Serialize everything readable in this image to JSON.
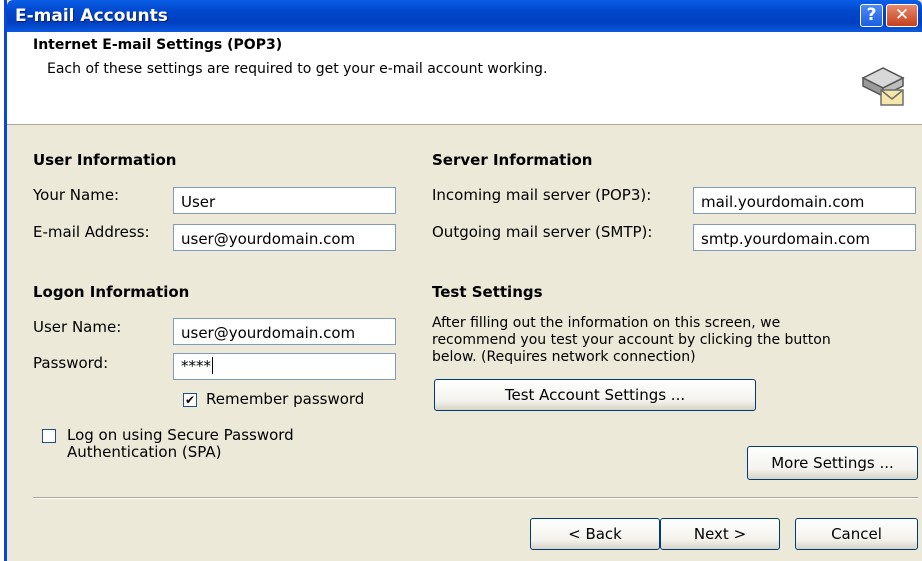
{
  "window": {
    "title": "E-mail Accounts",
    "help_glyph": "?",
    "close_glyph": "✕"
  },
  "header": {
    "title": "Internet E-mail Settings (POP3)",
    "subtitle": "Each of these settings are required to get your e-mail account working.",
    "icon": "mail-server-icon"
  },
  "user_info": {
    "heading": "User Information",
    "name_label": "Your Name:",
    "name_value": "User",
    "email_label": "E-mail Address:",
    "email_value": "user@yourdomain.com"
  },
  "server_info": {
    "heading": "Server Information",
    "incoming_label": "Incoming mail server (POP3):",
    "incoming_value": "mail.yourdomain.com",
    "outgoing_label": "Outgoing mail server (SMTP):",
    "outgoing_value": "smtp.yourdomain.com"
  },
  "logon_info": {
    "heading": "Logon Information",
    "username_label": "User Name:",
    "username_value": "user@yourdomain.com",
    "password_label": "Password:",
    "password_value": "****",
    "remember_label": "Remember password",
    "remember_checked": true,
    "spa_label_line1": "Log on using Secure Password",
    "spa_label_line2": "Authentication (SPA)",
    "spa_checked": false
  },
  "test_settings": {
    "heading": "Test Settings",
    "line1": "After filling out the information on this screen, we",
    "line2": "recommend you test your account by clicking the button",
    "line3": "below. (Requires network connection)",
    "test_button": "Test Account Settings ..."
  },
  "more_settings_button": "More Settings ...",
  "footer": {
    "back": "< Back",
    "next": "Next >",
    "cancel": "Cancel"
  },
  "colors": {
    "titlebar": "#0047CC",
    "dialog_bg": "#ECE9D8",
    "field_border": "#7F9DB9"
  }
}
